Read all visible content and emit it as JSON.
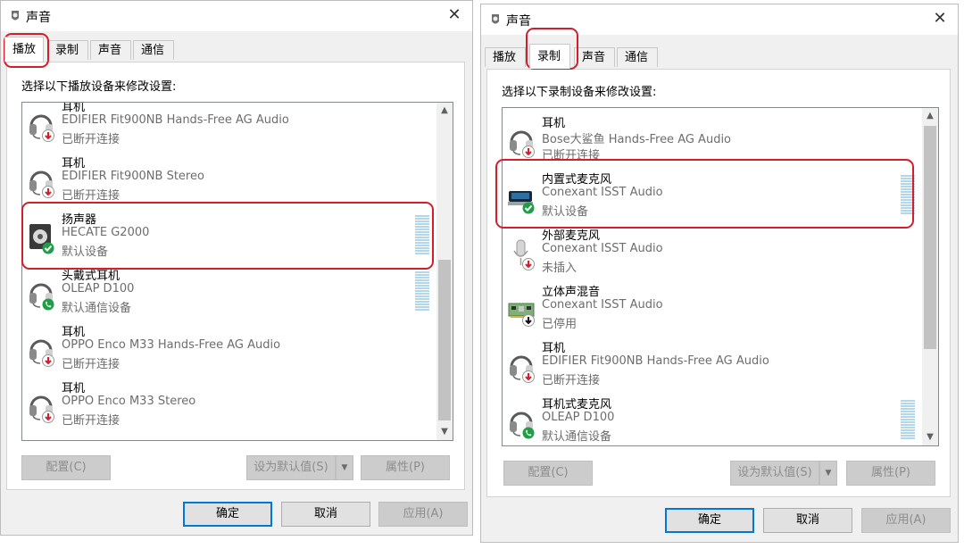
{
  "highlight_color": "#d21f2b",
  "left": {
    "title": "声音",
    "tabs": [
      "播放",
      "录制",
      "声音",
      "通信"
    ],
    "active_tab": "播放",
    "instruction": "选择以下播放设备来修改设置:",
    "devices": [
      {
        "name": "耳机",
        "driver": "EDIFIER Fit900NB Hands-Free AG Audio",
        "status": "已断开连接",
        "icon": "headset-icon",
        "badge": "disconnected-arrow"
      },
      {
        "name": "耳机",
        "driver": "EDIFIER Fit900NB Stereo",
        "status": "已断开连接",
        "icon": "headset-icon",
        "badge": "disconnected-arrow"
      },
      {
        "name": "扬声器",
        "driver": "HECATE G2000",
        "status": "默认设备",
        "icon": "speaker-icon",
        "badge": "default-check"
      },
      {
        "name": "头戴式耳机",
        "driver": "OLEAP D100",
        "status": "默认通信设备",
        "icon": "headset-icon",
        "badge": "communication-phone"
      },
      {
        "name": "耳机",
        "driver": "OPPO Enco M33 Hands-Free AG Audio",
        "status": "已断开连接",
        "icon": "headset-icon",
        "badge": "disconnected-arrow"
      },
      {
        "name": "耳机",
        "driver": "OPPO Enco M33 Stereo",
        "status": "已断开连接",
        "icon": "headset-icon",
        "badge": "disconnected-arrow"
      }
    ],
    "buttons": {
      "configure": "配置(C)",
      "set_default": "设为默认值(S)",
      "properties": "属性(P)",
      "ok": "确定",
      "cancel": "取消",
      "apply": "应用(A)"
    }
  },
  "right": {
    "title": "声音",
    "tabs": [
      "播放",
      "录制",
      "声音",
      "通信"
    ],
    "active_tab": "录制",
    "instruction": "选择以下录制设备来修改设置:",
    "devices": [
      {
        "name": "耳机",
        "driver": "Bose大鲨鱼 Hands-Free AG Audio",
        "status": "已断开连接",
        "icon": "headset-icon",
        "badge": "disconnected-arrow"
      },
      {
        "name": "内置式麦克风",
        "driver": "Conexant ISST Audio",
        "status": "默认设备",
        "icon": "laptop-mic-icon",
        "badge": "default-check"
      },
      {
        "name": "外部麦克风",
        "driver": "Conexant ISST Audio",
        "status": "未插入",
        "icon": "microphone-icon",
        "badge": "unplugged-arrow"
      },
      {
        "name": "立体声混音",
        "driver": "Conexant ISST Audio",
        "status": "已停用",
        "icon": "soundcard-icon",
        "badge": "disabled-arrow"
      },
      {
        "name": "耳机",
        "driver": "EDIFIER Fit900NB Hands-Free AG Audio",
        "status": "已断开连接",
        "icon": "headset-icon",
        "badge": "disconnected-arrow"
      },
      {
        "name": "耳机式麦克风",
        "driver": "OLEAP D100",
        "status": "默认通信设备",
        "icon": "headset-icon",
        "badge": "communication-phone"
      }
    ],
    "buttons": {
      "configure": "配置(C)",
      "set_default": "设为默认值(S)",
      "properties": "属性(P)",
      "ok": "确定",
      "cancel": "取消",
      "apply": "应用(A)"
    }
  }
}
